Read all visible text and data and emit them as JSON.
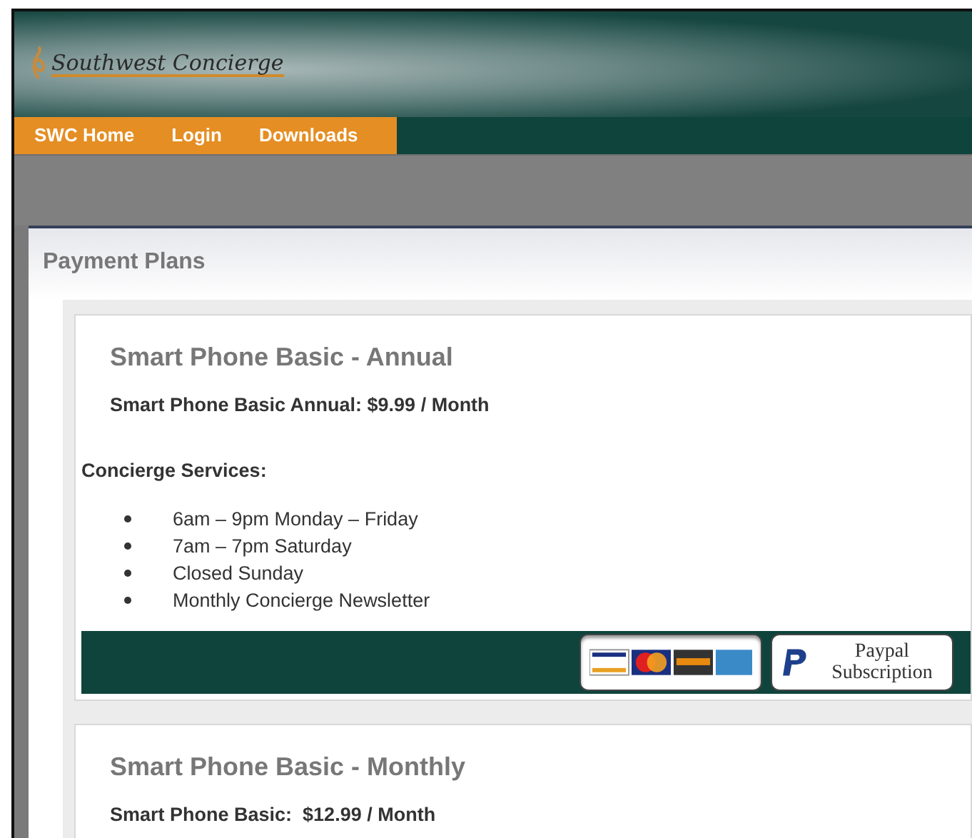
{
  "site": {
    "logo": "Southwest Concierge"
  },
  "nav": [
    {
      "label": "SWC Home"
    },
    {
      "label": "Login"
    },
    {
      "label": "Downloads"
    }
  ],
  "panel": {
    "title": "Payment Plans"
  },
  "plans": [
    {
      "title": "Smart Phone Basic - Annual",
      "price": "Smart Phone Basic Annual: $9.99 / Month",
      "services_heading": "Concierge Services:",
      "services": [
        "6am – 9pm Monday – Friday",
        "7am – 7pm Saturday",
        "Closed Sunday",
        "Monthly Concierge Newsletter"
      ],
      "paypal_button": "Paypal Subscription"
    },
    {
      "title": "Smart Phone Basic - Monthly",
      "price": "Smart Phone Basic:  $12.99 / Month"
    }
  ]
}
